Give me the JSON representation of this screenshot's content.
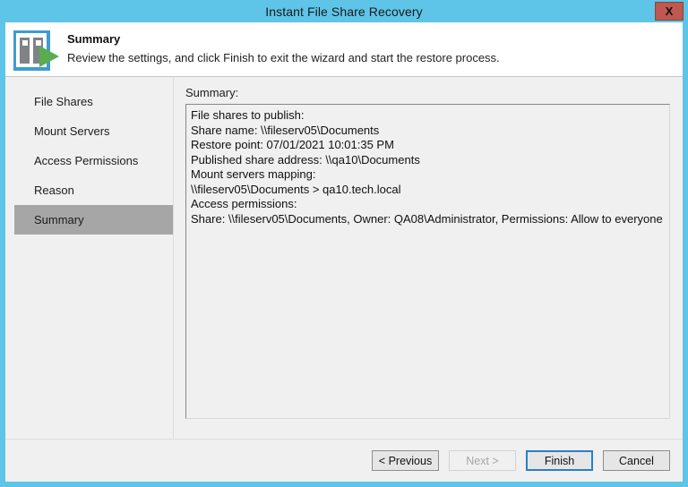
{
  "window": {
    "title": "Instant File Share Recovery",
    "close_label": "X",
    "close_icon": "close-icon",
    "accent_color": "#5ec5e8",
    "close_button_color": "#bf584f"
  },
  "header": {
    "icon": "file-share-recovery-icon",
    "title": "Summary",
    "subtitle": "Review the settings, and click Finish to exit the wizard and start the restore process."
  },
  "sidebar": {
    "items": [
      {
        "label": "File Shares",
        "selected": false
      },
      {
        "label": "Mount Servers",
        "selected": false
      },
      {
        "label": "Access Permissions",
        "selected": false
      },
      {
        "label": "Reason",
        "selected": false
      },
      {
        "label": "Summary",
        "selected": true
      }
    ],
    "selected_color": "#a6a6a6"
  },
  "main": {
    "label": "Summary:",
    "summary_lines": [
      "File shares to publish:",
      "Share name: \\\\fileserv05\\Documents",
      "Restore point: 07/01/2021 10:01:35 PM",
      "Published share address: \\\\qa10\\Documents",
      "Mount servers mapping:",
      "\\\\fileserv05\\Documents > qa10.tech.local",
      "Access permissions:",
      "Share: \\\\fileserv05\\Documents, Owner: QA08\\Administrator, Permissions: Allow to everyone"
    ]
  },
  "footer": {
    "buttons": [
      {
        "label": "< Previous",
        "state": "enabled"
      },
      {
        "label": "Next >",
        "state": "disabled"
      },
      {
        "label": "Finish",
        "state": "default"
      },
      {
        "label": "Cancel",
        "state": "enabled"
      }
    ]
  }
}
